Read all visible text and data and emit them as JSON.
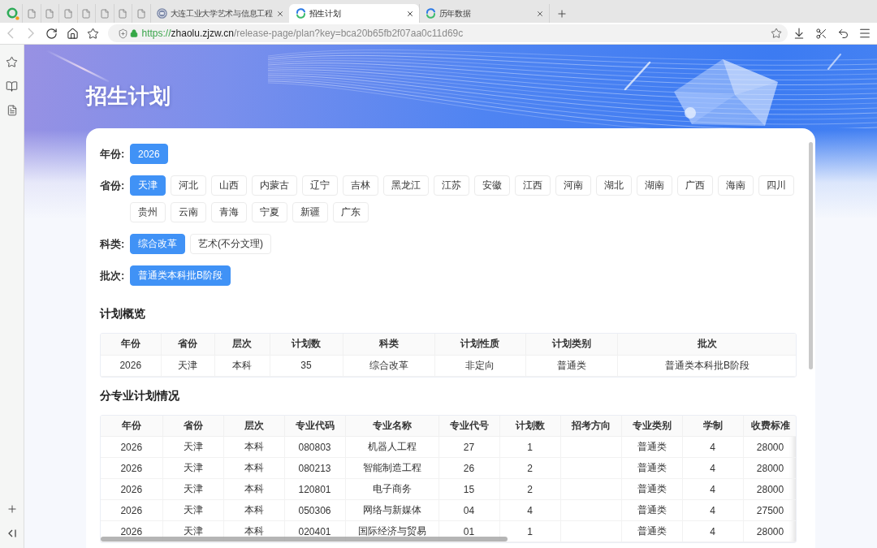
{
  "browser": {
    "pinned_tabs": [
      {
        "selected": false
      },
      {
        "selected": false
      },
      {
        "selected": false
      },
      {
        "selected": false
      },
      {
        "selected": false
      },
      {
        "selected": false
      },
      {
        "selected": false
      }
    ],
    "tabs": [
      {
        "title": "大连工业大学艺术与信息工程",
        "kind": "emblem",
        "selected": false
      },
      {
        "title": "招生计划",
        "kind": "swirl",
        "selected": true
      },
      {
        "title": "历年数据",
        "kind": "swirl",
        "selected": false
      }
    ],
    "back": {
      "disabled": true
    },
    "forward": {
      "disabled": true
    },
    "url": {
      "scheme": "https://",
      "host": "zhaolu.zjzw.cn",
      "path": "/release-page/plan?key=bca20b65fb2f07aa0c11d69c"
    }
  },
  "page": {
    "title": "招生计划"
  },
  "filters": [
    {
      "label": "年份:",
      "options": [
        {
          "label": "2026",
          "selected": true
        }
      ]
    },
    {
      "label": "省份:",
      "options": [
        {
          "label": "天津",
          "selected": true
        },
        {
          "label": "河北",
          "selected": false
        },
        {
          "label": "山西",
          "selected": false
        },
        {
          "label": "内蒙古",
          "selected": false
        },
        {
          "label": "辽宁",
          "selected": false
        },
        {
          "label": "吉林",
          "selected": false
        },
        {
          "label": "黑龙江",
          "selected": false
        },
        {
          "label": "江苏",
          "selected": false
        },
        {
          "label": "安徽",
          "selected": false
        },
        {
          "label": "江西",
          "selected": false
        },
        {
          "label": "河南",
          "selected": false
        },
        {
          "label": "湖北",
          "selected": false
        },
        {
          "label": "湖南",
          "selected": false
        },
        {
          "label": "广西",
          "selected": false
        },
        {
          "label": "海南",
          "selected": false
        },
        {
          "label": "四川",
          "selected": false
        },
        {
          "label": "贵州",
          "selected": false
        },
        {
          "label": "云南",
          "selected": false
        },
        {
          "label": "青海",
          "selected": false
        },
        {
          "label": "宁夏",
          "selected": false
        },
        {
          "label": "新疆",
          "selected": false
        },
        {
          "label": "广东",
          "selected": false
        }
      ]
    },
    {
      "label": "科类:",
      "options": [
        {
          "label": "综合改革",
          "selected": true
        },
        {
          "label": "艺术(不分文理)",
          "selected": false
        }
      ]
    },
    {
      "label": "批次:",
      "options": [
        {
          "label": "普通类本科批B阶段",
          "selected": true
        }
      ]
    }
  ],
  "overview": {
    "title": "计划概览",
    "columns": [
      "年份",
      "省份",
      "层次",
      "计划数",
      "科类",
      "计划性质",
      "计划类别",
      "批次"
    ],
    "rows": [
      [
        "2026",
        "天津",
        "本科",
        "35",
        "综合改革",
        "非定向",
        "普通类",
        "普通类本科批B阶段"
      ]
    ]
  },
  "majors": {
    "title": "分专业计划情况",
    "columns": [
      "年份",
      "省份",
      "层次",
      "专业代码",
      "专业名称",
      "专业代号",
      "计划数",
      "招考方向",
      "专业类别",
      "学制",
      "收费标准"
    ],
    "rows": [
      [
        "2026",
        "天津",
        "本科",
        "080803",
        "机器人工程",
        "27",
        "1",
        null,
        "普通类",
        "4",
        "28000"
      ],
      [
        "2026",
        "天津",
        "本科",
        "080213",
        "智能制造工程",
        "26",
        "2",
        null,
        "普通类",
        "4",
        "28000"
      ],
      [
        "2026",
        "天津",
        "本科",
        "120801",
        "电子商务",
        "15",
        "2",
        null,
        "普通类",
        "4",
        "28000"
      ],
      [
        "2026",
        "天津",
        "本科",
        "050306",
        "网络与新媒体",
        "04",
        "4",
        null,
        "普通类",
        "4",
        "27500"
      ],
      [
        "2026",
        "天津",
        "本科",
        "020401",
        "国际经济与贸易",
        "01",
        "1",
        null,
        "普通类",
        "4",
        "28000"
      ]
    ]
  }
}
